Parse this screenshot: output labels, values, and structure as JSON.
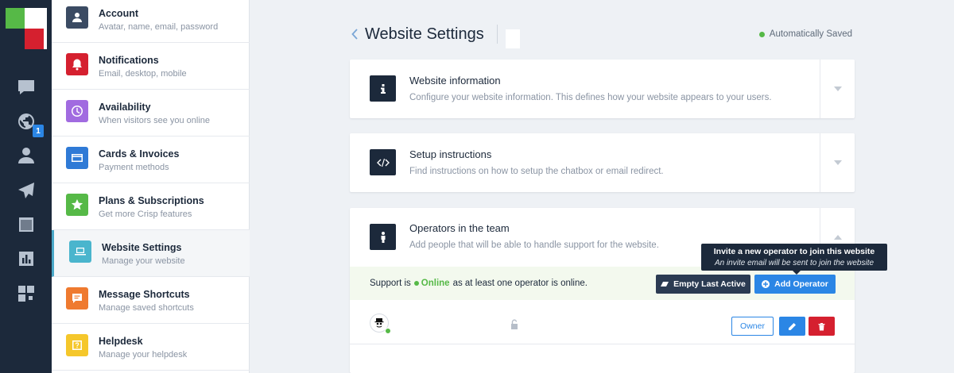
{
  "rail": {
    "items": [
      {
        "icon": "chat-icon"
      },
      {
        "icon": "globe-icon",
        "badge": "1"
      },
      {
        "icon": "contacts-icon"
      },
      {
        "icon": "send-icon"
      },
      {
        "icon": "book-icon"
      },
      {
        "icon": "analytics-icon"
      },
      {
        "icon": "plugins-icon"
      }
    ]
  },
  "menu": {
    "items": [
      {
        "title": "Account",
        "subtitle": "Avatar, name, email, password",
        "color": "#3b4b63",
        "icon": "user-icon"
      },
      {
        "title": "Notifications",
        "subtitle": "Email, desktop, mobile",
        "color": "#d5202f",
        "icon": "bell-icon"
      },
      {
        "title": "Availability",
        "subtitle": "When visitors see you online",
        "color": "#a16be0",
        "icon": "clock-icon"
      },
      {
        "title": "Cards & Invoices",
        "subtitle": "Payment methods",
        "color": "#2f7ad6",
        "icon": "card-icon"
      },
      {
        "title": "Plans & Subscriptions",
        "subtitle": "Get more Crisp features",
        "color": "#56b947",
        "icon": "star-icon"
      },
      {
        "title": "Website Settings",
        "subtitle": "Manage your website",
        "color": "#4ab5cd",
        "icon": "laptop-icon",
        "active": true
      },
      {
        "title": "Message Shortcuts",
        "subtitle": "Manage saved shortcuts",
        "color": "#ef7a2f",
        "icon": "message-icon"
      },
      {
        "title": "Helpdesk",
        "subtitle": "Manage your helpdesk",
        "color": "#f5c72b",
        "icon": "help-icon"
      }
    ]
  },
  "header": {
    "title": "Website Settings",
    "saved": "Automatically Saved"
  },
  "sections": {
    "info": {
      "title": "Website information",
      "desc": "Configure your website information. This defines how your website appears to your users."
    },
    "setup": {
      "title": "Setup instructions",
      "desc": "Find instructions on how to setup the chatbox or email redirect."
    },
    "operators": {
      "title": "Operators in the team",
      "desc": "Add people that will be able to handle support for the website."
    }
  },
  "support": {
    "prefix": "Support is",
    "status": "Online",
    "suffix": "as at least one operator is online."
  },
  "buttons": {
    "empty_last_active": "Empty Last Active",
    "add_operator": "Add Operator",
    "owner": "Owner"
  },
  "tooltip": {
    "line1": "Invite a new operator to join this website",
    "line2": "An invite email will be sent to join the website"
  },
  "colors": {
    "rail": "#1c293b",
    "accent": "#2b86e5",
    "online": "#56b947",
    "danger": "#d5202f"
  }
}
